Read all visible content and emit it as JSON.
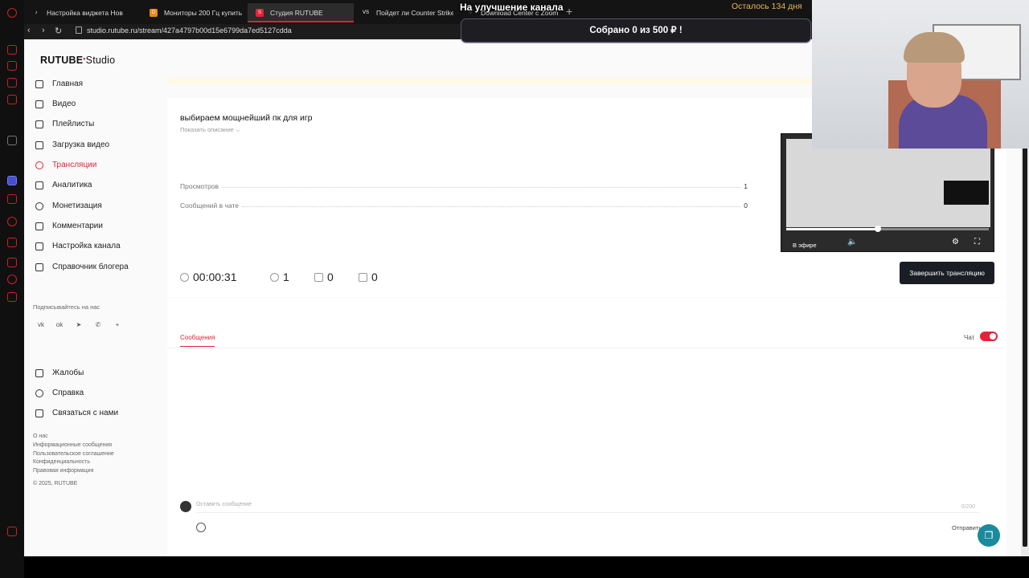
{
  "browser": {
    "tabs": [
      {
        "label": "Настройка виджета Нов",
        "fav": "♪",
        "color": "#444"
      },
      {
        "label": "Мониторы 200 Гц купить",
        "fav": "D",
        "color": "#e88a1a"
      },
      {
        "label": "Студия RUTUBE",
        "fav": "S",
        "color": "#e2243a"
      },
      {
        "label": "Пойдет ли Counter Strike",
        "fav": "VS",
        "color": "#333"
      },
      {
        "label": "Download Center с Zoom",
        "fav": "◌",
        "color": "#444"
      }
    ],
    "new_tab": "+",
    "url": "studio.rutube.ru/stream/427a4797b00d15e6799da7ed5127cdda"
  },
  "overlay": {
    "donation_title": "На улучшение канала",
    "days_left": "Осталось 134 дня",
    "collected": "Собрано 0  из 500 ₽ !"
  },
  "sidebar": {
    "logo_brand": "RUTUBE",
    "logo_studio": "Studio",
    "items": [
      {
        "label": "Главная",
        "active": false
      },
      {
        "label": "Видео",
        "active": false
      },
      {
        "label": "Плейлисты",
        "active": false
      },
      {
        "label": "Загрузка видео",
        "active": false
      },
      {
        "label": "Трансляции",
        "active": true
      },
      {
        "label": "Аналитика",
        "active": false
      },
      {
        "label": "Монетизация",
        "active": false
      },
      {
        "label": "Комментарии",
        "active": false
      },
      {
        "label": "Настройка канала",
        "active": false
      },
      {
        "label": "Справочник блогера",
        "active": false
      }
    ],
    "subscribe_label": "Подписывайтесь на нас",
    "social": [
      "vk",
      "ok",
      "tg",
      "viber",
      "+"
    ],
    "bottom_items": [
      {
        "label": "Жалобы"
      },
      {
        "label": "Справка"
      },
      {
        "label": "Связаться с нами"
      }
    ],
    "footer_links": [
      "О нас",
      "Информационные сообщения",
      "Пользовательское соглашение",
      "Конфиденциальность",
      "Правовая информация",
      "© 2025, RUTUBE"
    ]
  },
  "stream": {
    "title": "выбираем мощнейший пк для игр",
    "show_description": "Показать описание ⌵",
    "stats": [
      {
        "label": "Просмотров",
        "value": "1"
      },
      {
        "label": "Сообщений в чате",
        "value": "0"
      }
    ],
    "duration": "00:00:31",
    "viewers": "1",
    "likes": "0",
    "dislikes": "0",
    "end_button": "Завершить трансляцию",
    "preview_live": "В эфире",
    "preview_progress": 0.46
  },
  "chat": {
    "tab_messages": "Сообщения",
    "chat_toggle_label": "Чат",
    "input_placeholder": "Оставить сообщение",
    "char_count": "0/200",
    "send_label": "Отправить"
  },
  "colors": {
    "accent": "#e2243a",
    "end_button_bg": "#1b1d24",
    "days_left": "#e8b65a"
  }
}
